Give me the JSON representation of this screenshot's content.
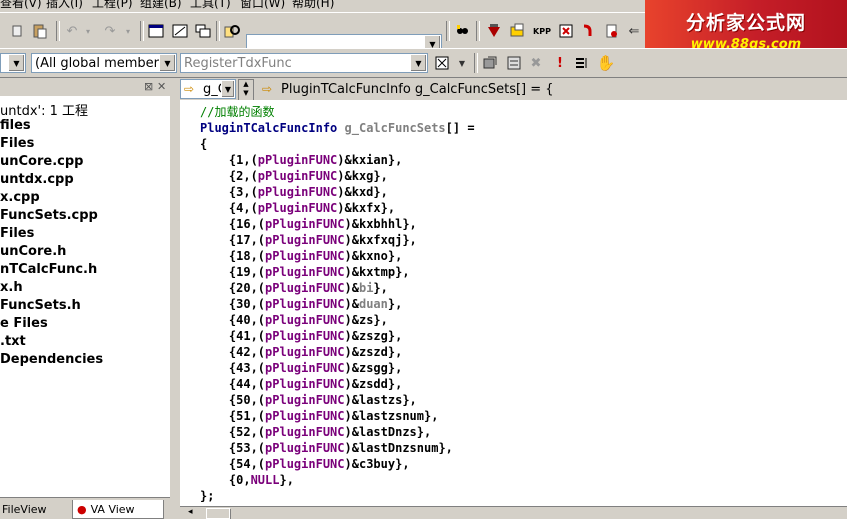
{
  "menu": [
    "查看(V)",
    "插入(I)",
    "工程(P)",
    "组建(B)",
    "工具(T)",
    "窗口(W)",
    "帮助(H)"
  ],
  "toolbar": {
    "search_value": "",
    "members_filter": "(All global members",
    "function_filter": "RegisterTdxFunc",
    "symbol_combo": "g_C",
    "symbol_declaration": "PluginTCalcFuncInfo g_CalcFuncSets[] = {"
  },
  "logo": {
    "title": "分析家公式网",
    "url": "www.88gs.com"
  },
  "file_tree": [
    "untdx': 1 工程",
    "files",
    "Files",
    "unCore.cpp",
    "untdx.cpp",
    "x.cpp",
    "FuncSets.cpp",
    "Files",
    "unCore.h",
    "nTCalcFunc.h",
    "x.h",
    "FuncSets.h",
    "e Files",
    ".txt",
    " Dependencies"
  ],
  "tabs": {
    "file_view": "FileView",
    "va_view": "VA View"
  },
  "code": {
    "comment": "//加载的函数",
    "decl_type": "PluginTCalcFuncInfo",
    "decl_name": "g_CalcFuncSets[] =",
    "open": "{",
    "close": "};",
    "entries": [
      {
        "id": "1",
        "fn": "xian"
      },
      {
        "id": "2",
        "fn": "xg"
      },
      {
        "id": "3",
        "fn": "xd"
      },
      {
        "id": "4",
        "fn": "xfx"
      },
      {
        "id": "16",
        "fn": "xbhhl"
      },
      {
        "id": "17",
        "fn": "xfxqj"
      },
      {
        "id": "18",
        "fn": "xno"
      },
      {
        "id": "19",
        "fn": "xtmp"
      },
      {
        "id": "20",
        "fn": "bi"
      },
      {
        "id": "30",
        "fn": "duan"
      },
      {
        "id": "40",
        "fn": "zs"
      },
      {
        "id": "41",
        "fn": "zszg"
      },
      {
        "id": "42",
        "fn": "zszd"
      },
      {
        "id": "43",
        "fn": "zsgg"
      },
      {
        "id": "44",
        "fn": "zsdd"
      },
      {
        "id": "50",
        "fn": "lastzs"
      },
      {
        "id": "51",
        "fn": "lastzsnum"
      },
      {
        "id": "52",
        "fn": "lastDnzs"
      },
      {
        "id": "53",
        "fn": "lastDnzsnum"
      },
      {
        "id": "54",
        "fn": "c3buy"
      }
    ],
    "cast": "(pPluginFUNC)",
    "terminator_id": "0",
    "terminator_null": "NULL",
    "colors": {
      "keyword": "#7a007a",
      "comment": "#008000",
      "type": "#000080",
      "identifier": "#808080"
    }
  }
}
